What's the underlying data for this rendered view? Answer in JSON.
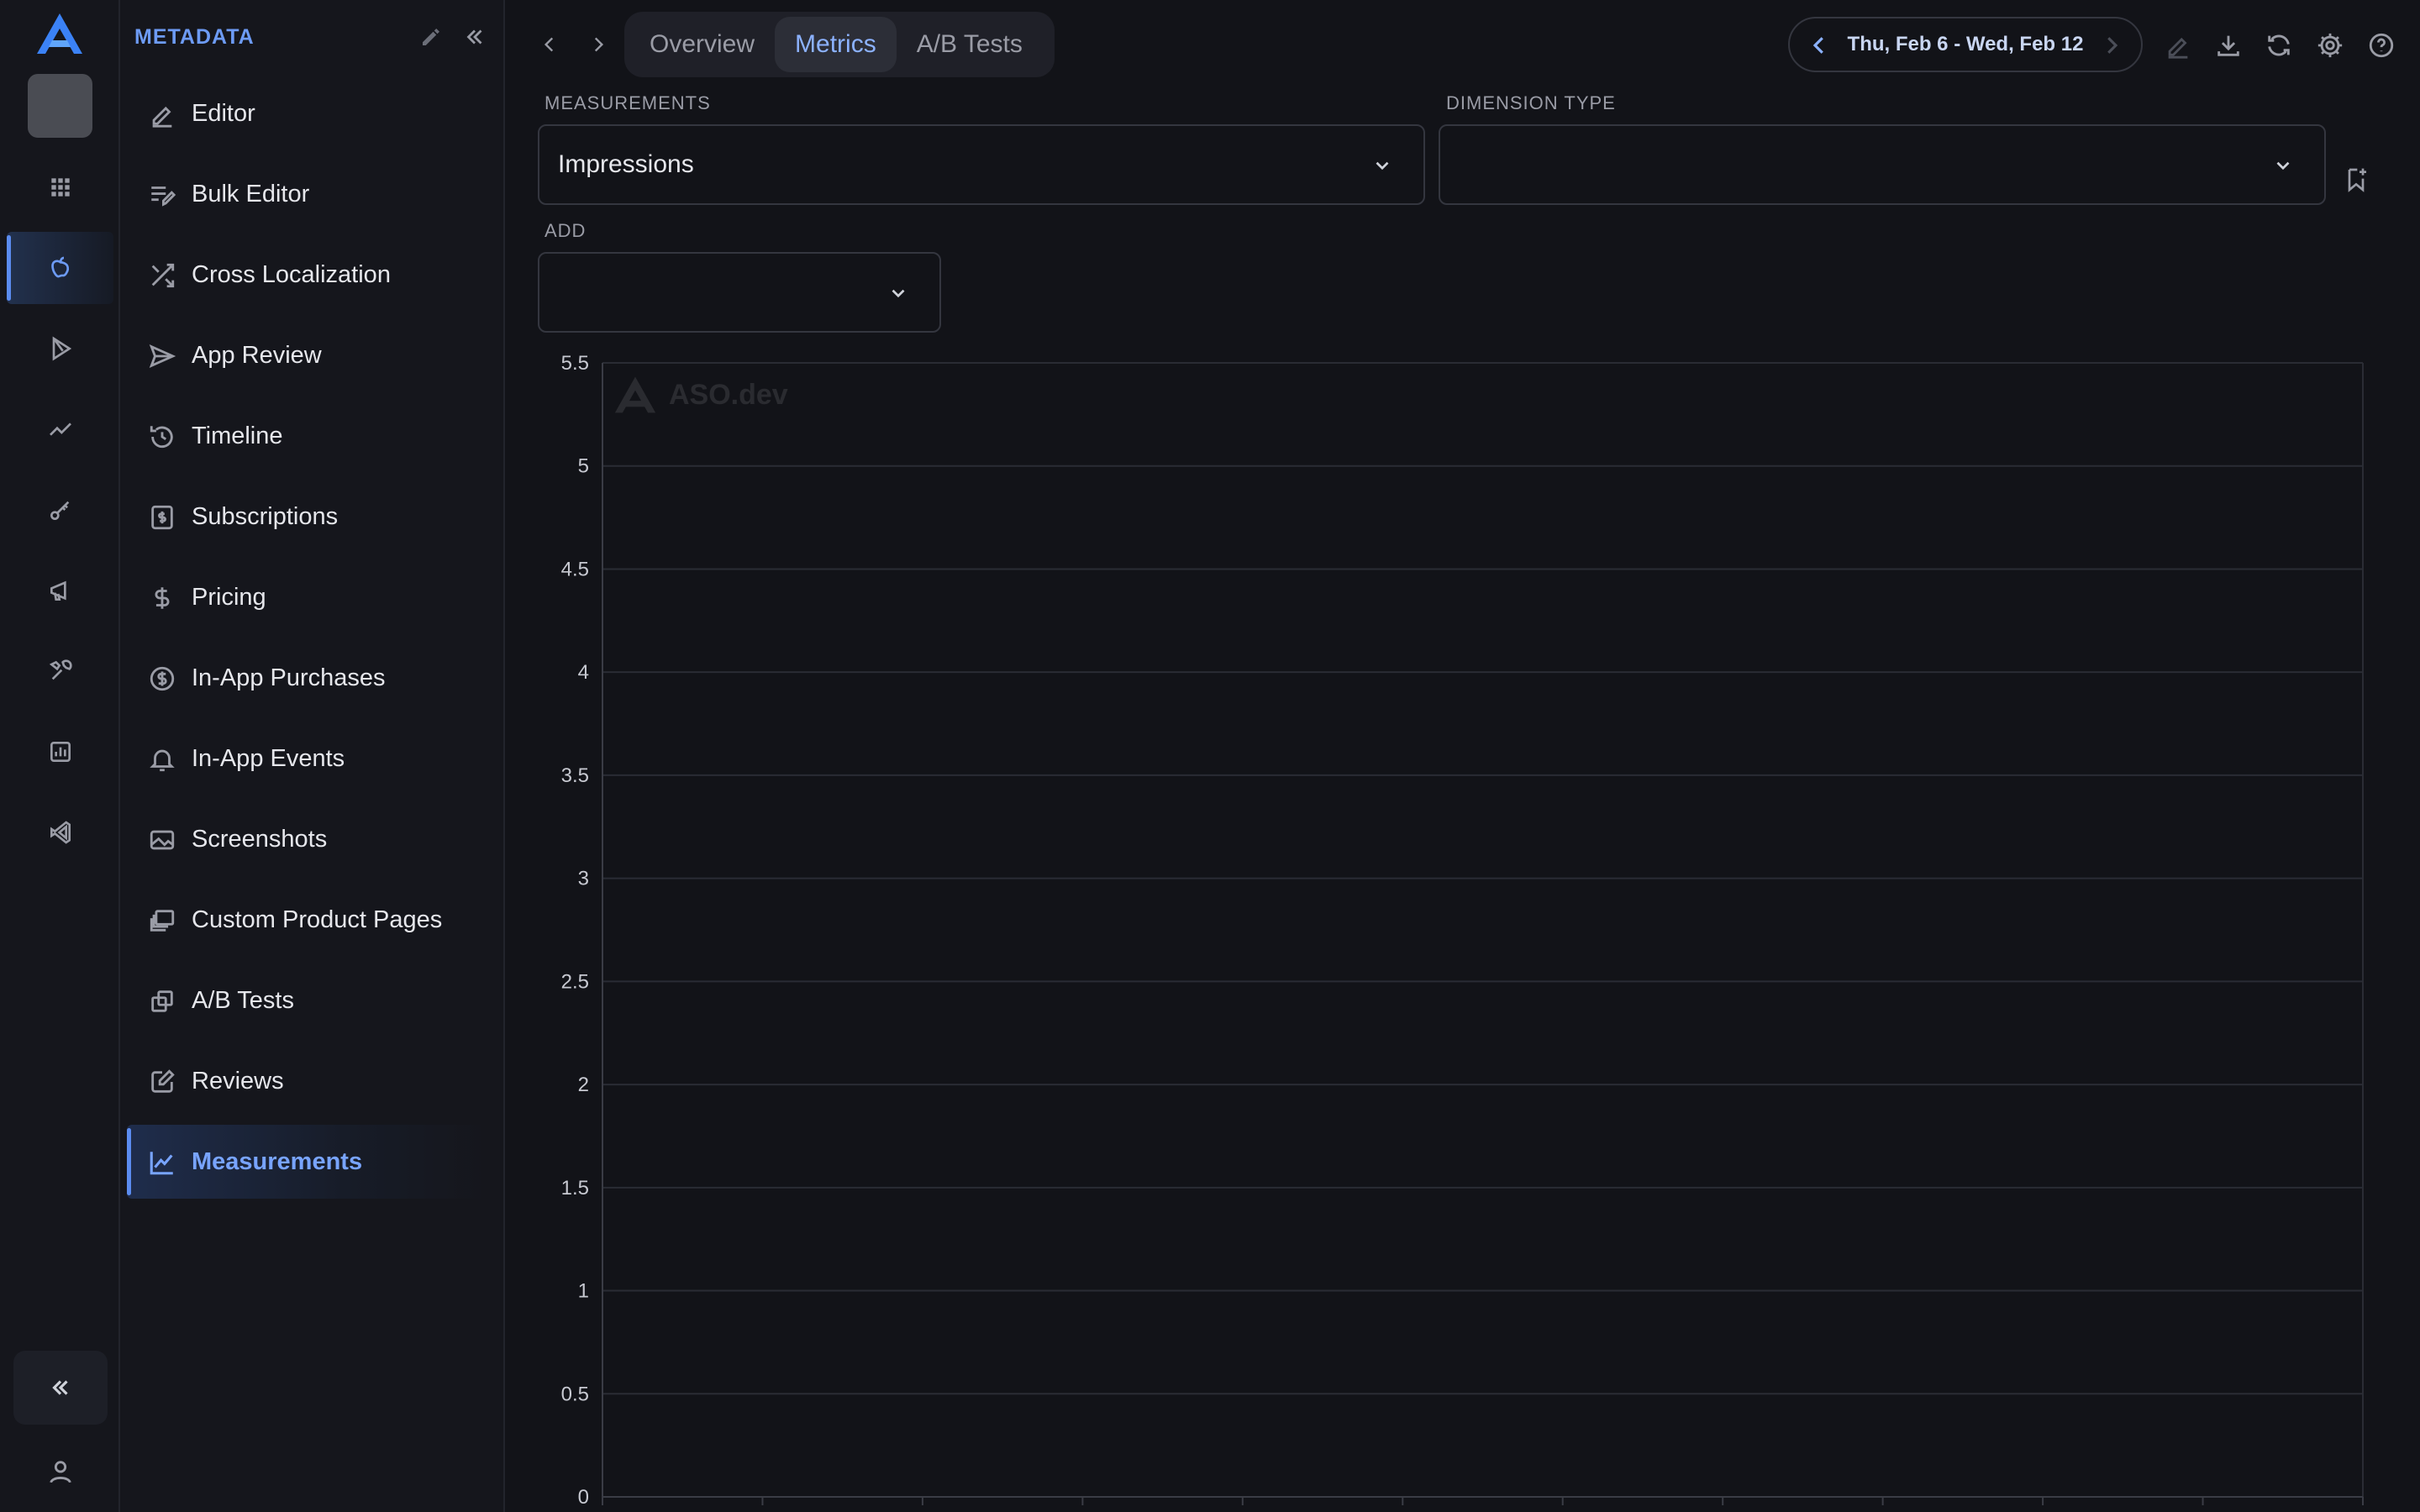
{
  "rail": {
    "items": [
      {
        "name": "rail-grid",
        "icon": "grid-icon"
      },
      {
        "name": "rail-apple",
        "icon": "apple-icon"
      },
      {
        "name": "rail-play",
        "icon": "play-store-icon"
      },
      {
        "name": "rail-trend",
        "icon": "trend-icon"
      },
      {
        "name": "rail-key",
        "icon": "key-icon"
      },
      {
        "name": "rail-megaphone",
        "icon": "megaphone-icon"
      },
      {
        "name": "rail-tools",
        "icon": "tools-icon"
      },
      {
        "name": "rail-reports",
        "icon": "bar-chart-icon"
      },
      {
        "name": "rail-vscode",
        "icon": "vscode-icon"
      }
    ],
    "active_item": "apple-icon"
  },
  "sidebar": {
    "title": "METADATA",
    "items": [
      {
        "label": "Editor",
        "icon": "pencil-icon"
      },
      {
        "label": "Bulk Editor",
        "icon": "list-edit-icon"
      },
      {
        "label": "Cross Localization",
        "icon": "shuffle-icon"
      },
      {
        "label": "App Review",
        "icon": "send-icon"
      },
      {
        "label": "Timeline",
        "icon": "history-icon"
      },
      {
        "label": "Subscriptions",
        "icon": "receipt-dollar-icon"
      },
      {
        "label": "Pricing",
        "icon": "dollar-icon"
      },
      {
        "label": "In-App Purchases",
        "icon": "coin-icon"
      },
      {
        "label": "In-App Events",
        "icon": "bell-icon"
      },
      {
        "label": "Screenshots",
        "icon": "image-icon"
      },
      {
        "label": "Custom Product Pages",
        "icon": "layers-icon"
      },
      {
        "label": "A/B Tests",
        "icon": "copy-icon"
      },
      {
        "label": "Reviews",
        "icon": "edit-note-icon"
      },
      {
        "label": "Measurements",
        "icon": "line-chart-icon"
      }
    ],
    "active_item": "Measurements"
  },
  "tabs": [
    "Overview",
    "Metrics",
    "A/B Tests"
  ],
  "active_tab": "Metrics",
  "date_range": "Thu, Feb 6 - Wed, Feb 12",
  "filters": {
    "measurements_label": "MEASUREMENTS",
    "measurements_value": "Impressions",
    "dimension_label": "DIMENSION TYPE",
    "dimension_value": "",
    "add_label": "ADD",
    "add_value": ""
  },
  "colors": {
    "accent": "#6d9bf5",
    "background": "#121318",
    "sidebar_bg": "#15161c",
    "grid": "#2a2c34"
  },
  "watermark": "ASO.dev",
  "chart_data": {
    "type": "line",
    "title": "",
    "xlabel": "",
    "ylabel": "",
    "ylim": [
      0,
      5.5
    ],
    "y_ticks": [
      "0",
      "0.5",
      "1",
      "1.5",
      "2",
      "2.5",
      "3",
      "3.5",
      "4",
      "4.5",
      "5",
      "5.5"
    ],
    "x_tick_count": 12,
    "series": [],
    "grid": true
  }
}
